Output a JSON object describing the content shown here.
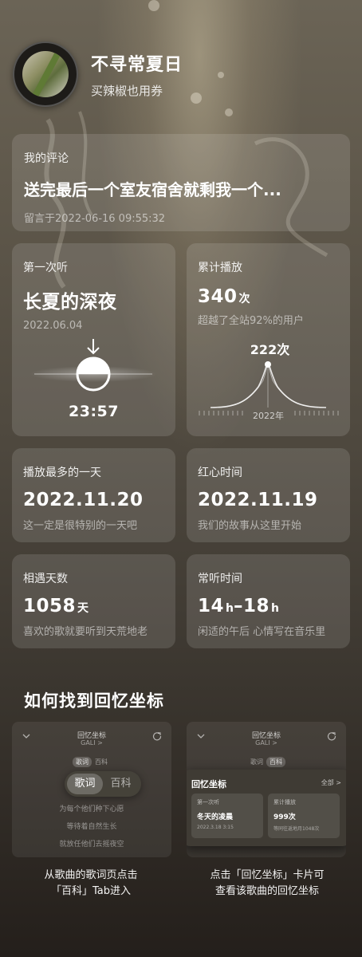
{
  "song": {
    "title": "不寻常夏日",
    "artist": "买辣椒也用券"
  },
  "comment": {
    "label": "我的评论",
    "text": "送完最后一个室友宿舍就剩我一个...",
    "time": "留言于2022-06-16 09:55:32"
  },
  "first_listen": {
    "label": "第一次听",
    "value": "长夏的深夜",
    "date": "2022.06.04",
    "time": "23:57"
  },
  "total_plays": {
    "label": "累计播放",
    "count": "340",
    "unit": "次",
    "sub": "超越了全站92%的用户",
    "peak_label": "222次",
    "year_label": "2022年",
    "peak_value": 222
  },
  "most_played_day": {
    "label": "播放最多的一天",
    "value": "2022.11.20",
    "sub": "这一定是很特别的一天吧"
  },
  "liked_time": {
    "label": "红心时间",
    "value": "2022.11.19",
    "sub": "我们的故事从这里开始"
  },
  "days_met": {
    "label": "相遇天数",
    "count": "1058",
    "unit": "天",
    "sub": "喜欢的歌就要听到天荒地老"
  },
  "listen_hours": {
    "label": "常听时间",
    "start": "14",
    "end": "18",
    "unit": "h",
    "dash": "–",
    "sub": "闲适的午后 心情写在音乐里"
  },
  "howto": {
    "title": "如何找到回忆坐标",
    "left": {
      "header_title": "回忆坐标",
      "header_sub": "GALI >",
      "tabs": [
        "歌词",
        "百科"
      ],
      "pill": [
        "歌词",
        "百科"
      ],
      "lyrics": [
        "为每个他们种下心愿",
        "等待着自然生长",
        "就放任他们去摇夜空"
      ],
      "caption_line1": "从歌曲的歌词页点击",
      "caption_line2": "「百科」Tab进入"
    },
    "right": {
      "header_title": "回忆坐标",
      "header_sub": "GALI >",
      "tabs": [
        "歌词",
        "百科"
      ],
      "popup_title": "回忆坐标",
      "popup_all": "全部 >",
      "card1": {
        "label": "第一次听",
        "value": "冬天的凌晨",
        "sub": "2022.3.18 3:15"
      },
      "card2": {
        "label": "累计播放",
        "value": "999次",
        "sub": "等同往返地月1048次"
      },
      "caption_line1": "点击「回忆坐标」卡片可",
      "caption_line2": "查看该歌曲的回忆坐标"
    }
  },
  "icons": {
    "arrow": "down-arrow-icon",
    "sun": "sunset-icon",
    "chevron": "chevron-down-icon",
    "share": "share-icon"
  }
}
